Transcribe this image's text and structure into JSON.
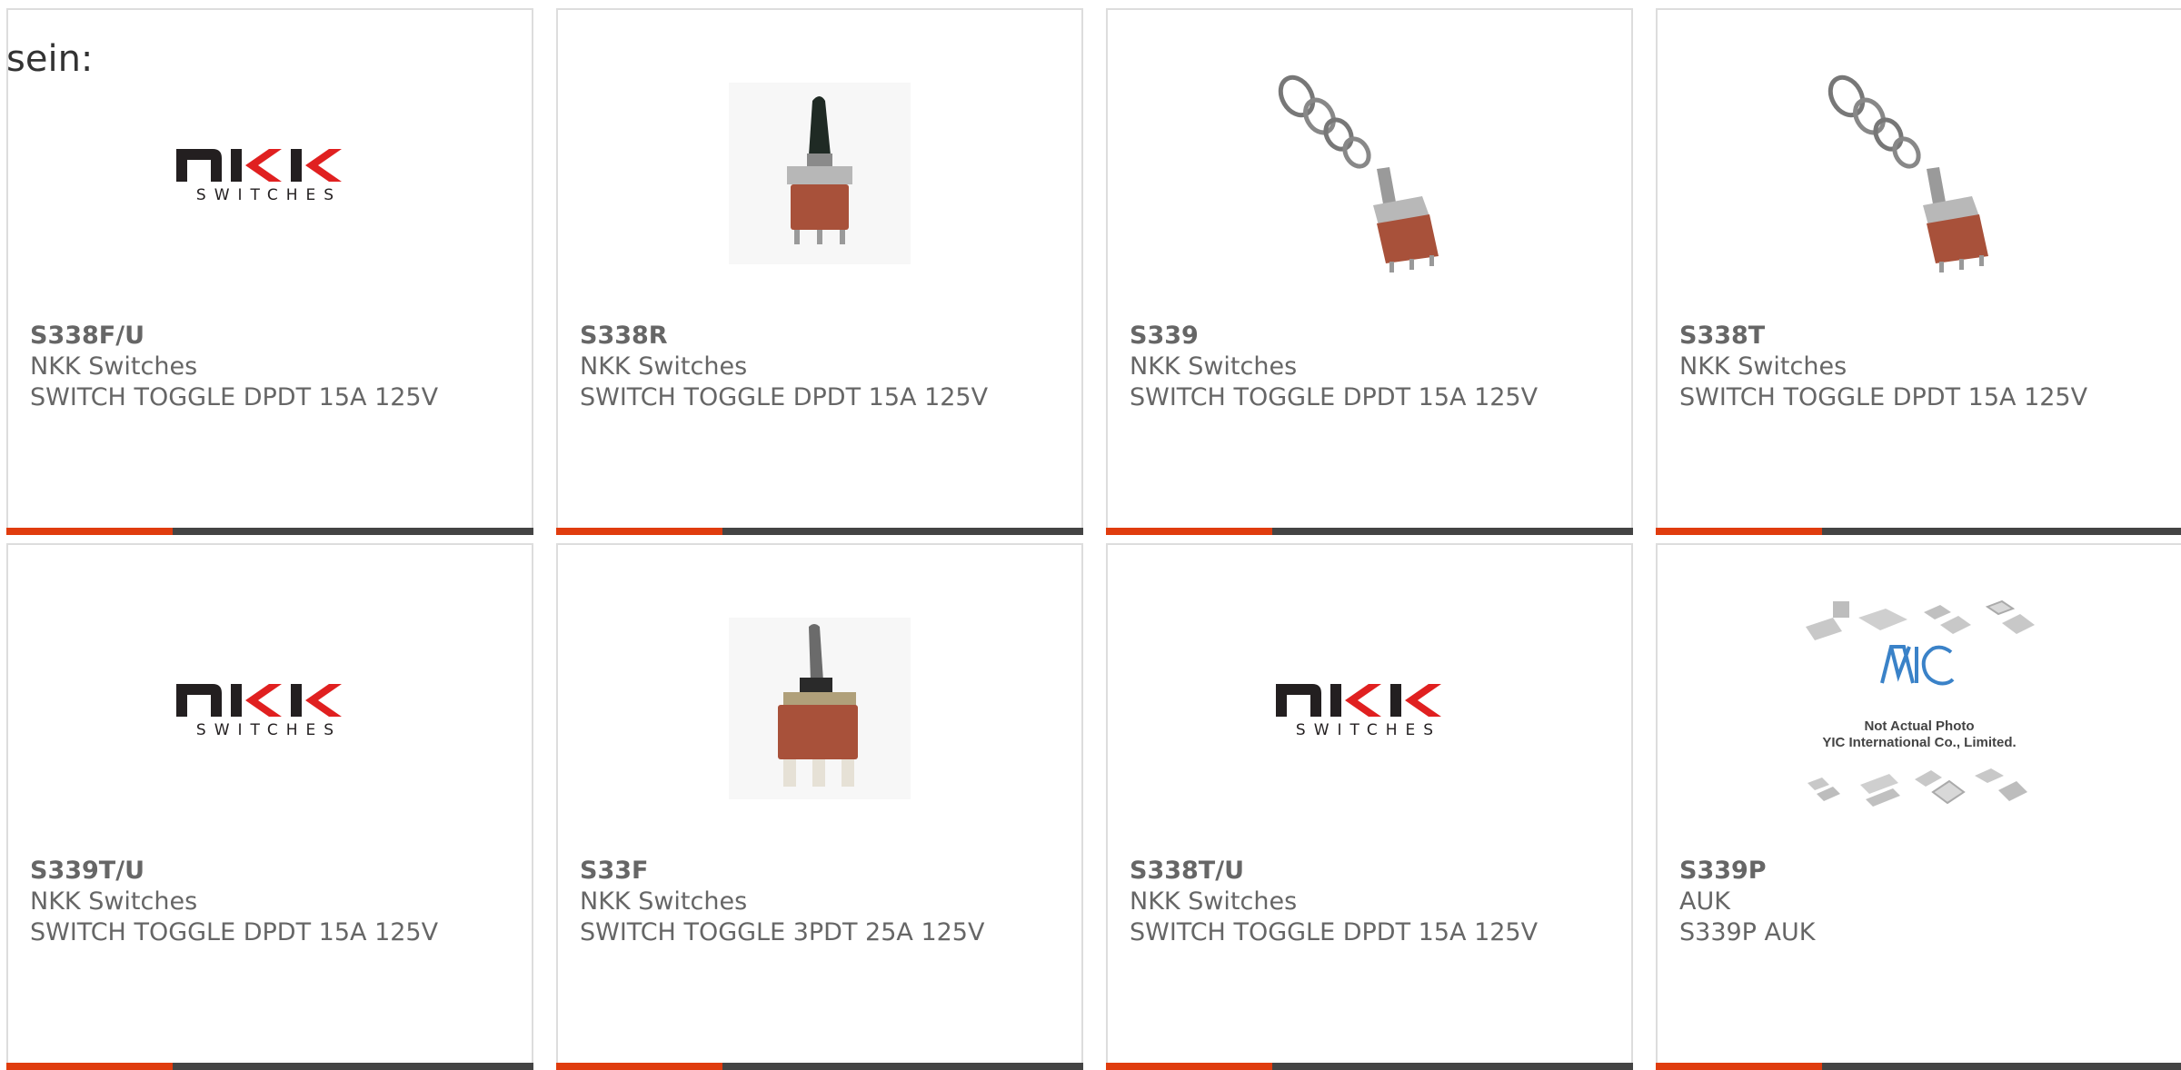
{
  "intro": {
    "text": "sein:"
  },
  "colors": {
    "accent": "#e03c0e",
    "bar": "#444444",
    "text": "#666666",
    "border": "#dddddd"
  },
  "products": [
    {
      "part": "S338F/U",
      "maker": "NKK Switches",
      "desc": "SWITCH TOGGLE DPDT 15A 125V",
      "image": "nkk-logo",
      "logo_text": "SWITCHES"
    },
    {
      "part": "S338R",
      "maker": "NKK Switches",
      "desc": "SWITCH TOGGLE DPDT 15A 125V",
      "image": "toggle-switch-paddle"
    },
    {
      "part": "S339",
      "maker": "NKK Switches",
      "desc": "SWITCH TOGGLE DPDT 15A 125V",
      "image": "toggle-switch-with-nuts"
    },
    {
      "part": "S338T",
      "maker": "NKK Switches",
      "desc": "SWITCH TOGGLE DPDT 15A 125V",
      "image": "toggle-switch-with-nuts"
    },
    {
      "part": "S339T/U",
      "maker": "NKK Switches",
      "desc": "SWITCH TOGGLE DPDT 15A 125V",
      "image": "nkk-logo",
      "logo_text": "SWITCHES"
    },
    {
      "part": "S33F",
      "maker": "NKK Switches",
      "desc": "SWITCH TOGGLE 3PDT 25A 125V",
      "image": "toggle-switch-3pdt"
    },
    {
      "part": "S338T/U",
      "maker": "NKK Switches",
      "desc": "SWITCH TOGGLE DPDT 15A 125V",
      "image": "nkk-logo",
      "logo_text": "SWITCHES"
    },
    {
      "part": "S339P",
      "maker": "AUK",
      "desc": "S339P AUK",
      "image": "yic-placeholder",
      "placeholder_line1": "Not Actual Photo",
      "placeholder_line2": "YIC International Co., Limited."
    }
  ]
}
